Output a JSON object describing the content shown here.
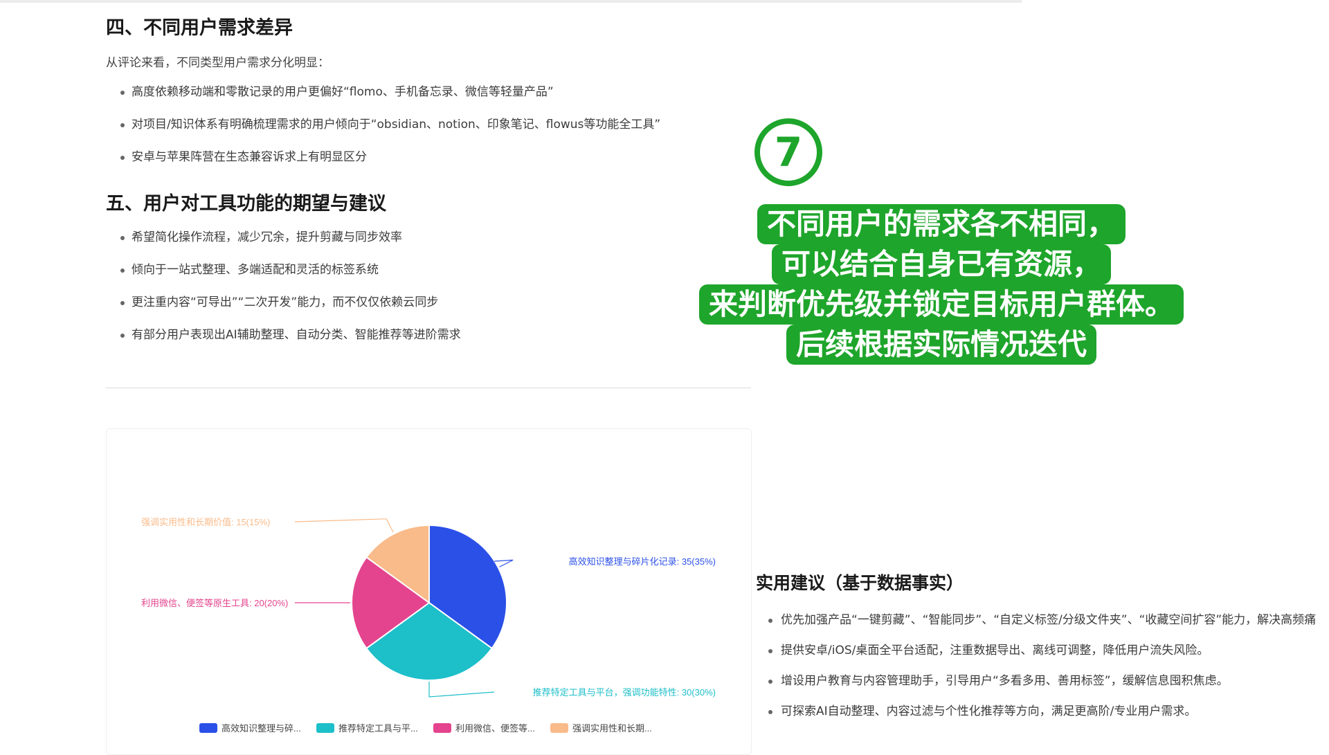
{
  "section4": {
    "title": "四、不同用户需求差异",
    "intro": "从评论来看，不同类型用户需求分化明显：",
    "items": [
      "高度依赖移动端和零散记录的用户更偏好“flomo、手机备忘录、微信等轻量产品”",
      "对项目/知识体系有明确梳理需求的用户倾向于“obsidian、notion、印象笔记、flowus等功能全工具”",
      "安卓与苹果阵营在生态兼容诉求上有明显区分"
    ]
  },
  "section5": {
    "title": "五、用户对工具功能的期望与建议",
    "items": [
      "希望简化操作流程，减少冗余，提升剪藏与同步效率",
      "倾向于一站式整理、多端适配和灵活的标签系统",
      "更注重内容“可导出”“二次开发”能力，而不仅仅依赖云同步",
      "有部分用户表现出AI辅助整理、自动分类、智能推荐等进阶需求"
    ]
  },
  "badge": {
    "number": "7",
    "color": "#1ea52b"
  },
  "callout": {
    "lines": [
      "不同用户的需求各不相同，",
      "可以结合自身已有资源，",
      "来判断优先级并锁定目标用户群体。",
      "后续根据实际情况迭代"
    ],
    "bg_color": "#1ea52b"
  },
  "chart_data": {
    "type": "pie",
    "slices": [
      {
        "name": "高效知识整理与碎片化记录",
        "value": 35,
        "percent": 35,
        "color": "#2b50e8",
        "label": "高效知识整理与碎片化记录: 35(35%)",
        "legend": "高效知识整理与碎..."
      },
      {
        "name": "推荐特定工具与平台，强调功能特性",
        "value": 30,
        "percent": 30,
        "color": "#1dbfc9",
        "label": "推荐特定工具与平台，强调功能特性: 30(30%)",
        "legend": "推荐特定工具与平..."
      },
      {
        "name": "利用微信、便签等原生工具",
        "value": 20,
        "percent": 20,
        "color": "#e4448e",
        "label": "利用微信、便签等原生工具: 20(20%)",
        "legend": "利用微信、便签等..."
      },
      {
        "name": "强调实用性和长期价值",
        "value": 15,
        "percent": 15,
        "color": "#f9bb8a",
        "label": "强调实用性和长期价值: 15(15%)",
        "legend": "强调实用性和长期..."
      }
    ],
    "legend_position": "bottom"
  },
  "suggestions": {
    "title": "实用建议（基于数据事实）",
    "items": [
      "优先加强产品“一键剪藏”、“智能同步”、“自定义标签/分级文件夹”、“收藏空间扩容”能力，解决高频痛",
      "提供安卓/iOS/桌面全平台适配，注重数据导出、离线可调整，降低用户流失风险。",
      "增设用户教育与内容管理助手，引导用户“多看多用、善用标签”，缓解信息囤积焦虑。",
      "可探索AI自动整理、内容过滤与个性化推荐等方向，满足更高阶/专业用户需求。"
    ]
  }
}
